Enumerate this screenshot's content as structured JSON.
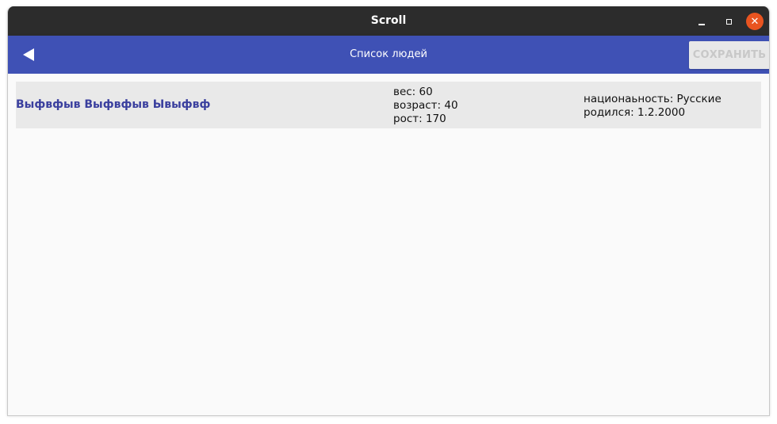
{
  "window": {
    "title": "Scroll",
    "close_color": "#e95420"
  },
  "appbar": {
    "title": "Список людей",
    "back_icon": "arrow-left-icon",
    "save_label": "СОХРАНИТЬ",
    "color": "#3f51b5"
  },
  "people": [
    {
      "name": "Выфвфыв Выфвфыв Ывыфвф",
      "weight": "вес: 60",
      "age": "возраст: 40",
      "height": "рост: 170",
      "nationality": "нациoнаьность: Русские",
      "born": "родился: 1.2.2000"
    }
  ]
}
